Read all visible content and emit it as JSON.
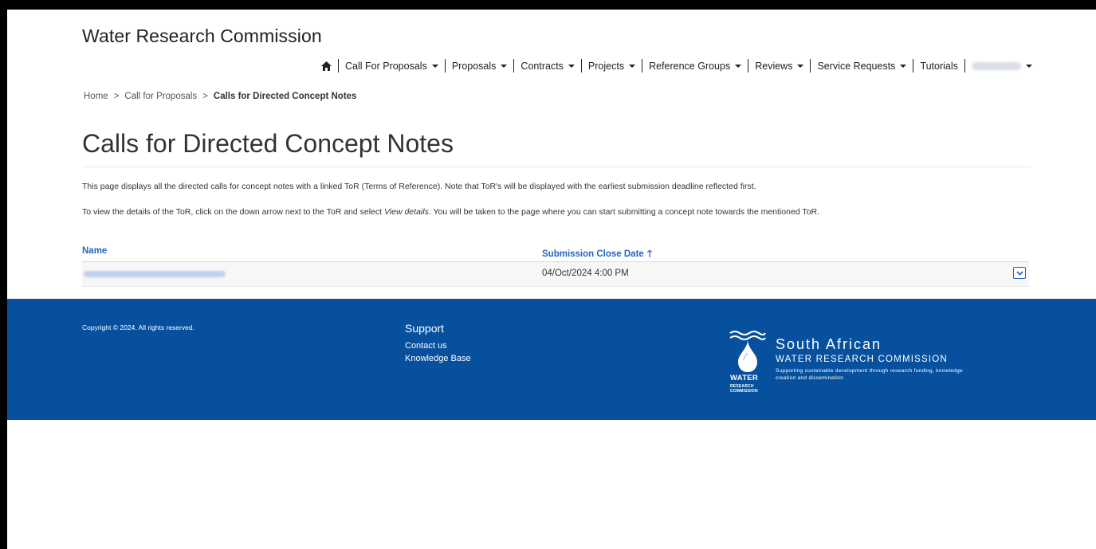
{
  "site": {
    "title": "Water Research Commission"
  },
  "nav": {
    "home_icon": "home-icon",
    "items": [
      {
        "label": "Call For Proposals",
        "dropdown": true
      },
      {
        "label": "Proposals",
        "dropdown": true
      },
      {
        "label": "Contracts",
        "dropdown": true
      },
      {
        "label": "Projects",
        "dropdown": true
      },
      {
        "label": "Reference Groups",
        "dropdown": true
      },
      {
        "label": "Reviews",
        "dropdown": true
      },
      {
        "label": "Service Requests",
        "dropdown": true
      },
      {
        "label": "Tutorials",
        "dropdown": false
      }
    ],
    "user_menu": {
      "dropdown": true
    }
  },
  "breadcrumb": {
    "items": [
      "Home",
      "Call for Proposals"
    ],
    "separator": ">",
    "current": "Calls for Directed Concept Notes"
  },
  "page": {
    "title": "Calls for Directed Concept Notes",
    "description_1": "This page displays all the directed calls for concept notes with a linked ToR (Terms of Reference). Note that ToR's will be displayed with the earliest submission deadline reflected first.",
    "description_2_pre": "To view the details of the ToR, click on the down arrow next to the ToR and select ",
    "description_2_em": "View details",
    "description_2_post": ". You will be taken to the page where you can start submitting a concept note towards the mentioned ToR."
  },
  "grid": {
    "columns": {
      "name": "Name",
      "close_date": "Submission Close Date",
      "sort_icon": "arrow-up-icon"
    },
    "rows": [
      {
        "date": "04/Oct/2024 4:00 PM"
      }
    ]
  },
  "footer": {
    "copyright": "Copyright © 2024. All rights reserved.",
    "support_title": "Support",
    "links": [
      "Contact us",
      "Knowledge Base"
    ],
    "logo": {
      "word": "WATER",
      "sub1": "RESEARCH",
      "sub2": "COMMISSION",
      "line1": "South African",
      "line2": "WATER RESEARCH COMMISSION",
      "line3": "Supporting sustainable development through research funding, knowledge creation and dissemination"
    }
  },
  "colors": {
    "link_blue": "#2563c9",
    "footer_blue": "#07509e"
  }
}
